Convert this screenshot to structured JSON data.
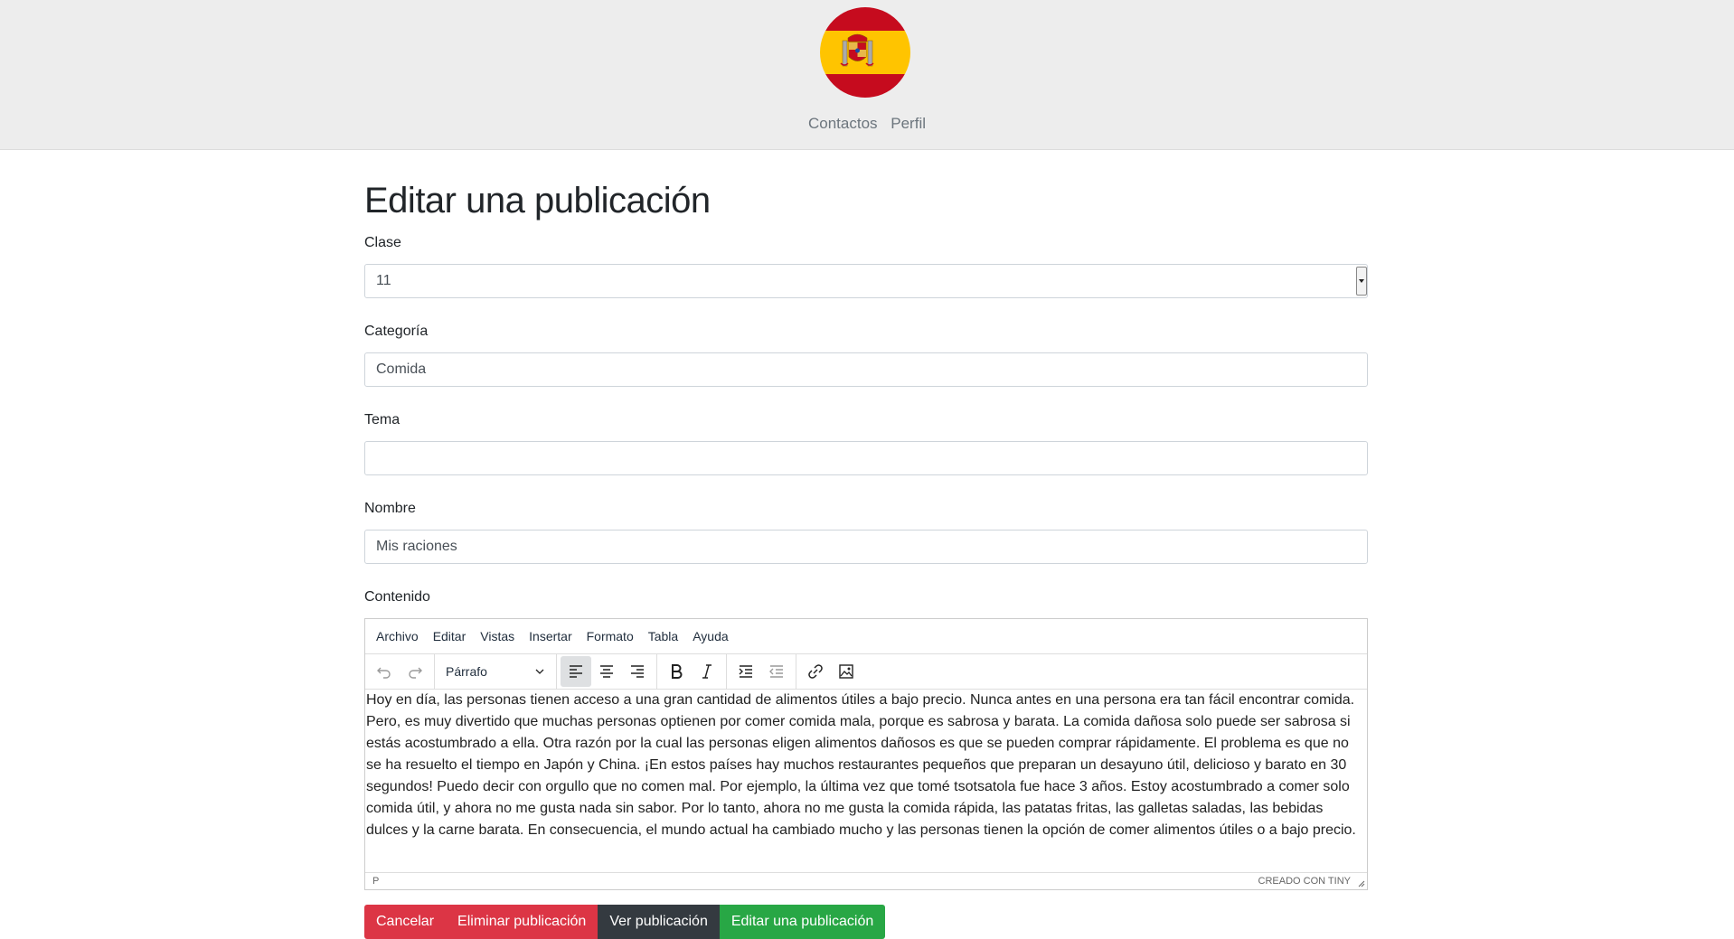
{
  "header": {
    "logo_icon": "spain-flag-coat-of-arms-logo",
    "nav": [
      "Contactos",
      "Perfil"
    ]
  },
  "page": {
    "title": "Editar una publicación"
  },
  "form": {
    "clase": {
      "label": "Clase",
      "value": "11"
    },
    "categoria": {
      "label": "Categoría",
      "value": "Comida"
    },
    "tema": {
      "label": "Tema",
      "value": ""
    },
    "nombre": {
      "label": "Nombre",
      "value": "Mis raciones"
    },
    "contenido": {
      "label": "Contenido"
    }
  },
  "editor": {
    "menu": [
      "Archivo",
      "Editar",
      "Vistas",
      "Insertar",
      "Formato",
      "Tabla",
      "Ayuda"
    ],
    "format_value": "Párrafo",
    "toolbar_icons": [
      "undo-icon",
      "redo-icon",
      "align-left-icon",
      "align-center-icon",
      "align-right-icon",
      "bold-icon",
      "italic-icon",
      "indent-icon",
      "outdent-icon",
      "link-icon",
      "image-icon"
    ],
    "content": "Hoy en día, las personas tienen acceso a una gran cantidad de alimentos útiles a bajo precio. Nunca antes en una persona era tan fácil encontrar comida. Pero, es muy divertido que muchas personas optienen por comer comida mala, porque es sabrosa y barata. La comida dañosa solo puede ser sabrosa si estás acostumbrado a ella. Otra razón por la cual las personas eligen alimentos dañosos es que se pueden comprar rápidamente. El problema es que no se ha resuelto el tiempo en Japón y China. ¡En estos países hay muchos restaurantes pequeños que preparan un desayuno útil, delicioso y barato en 30 segundos! Puedo decir con orgullo que no comen mal. Por ejemplo, la última vez que tomé tsotsatola fue hace 3 años. Estoy acostumbrado a comer solo comida útil, y ahora no me gusta nada sin sabor. Por lo tanto, ahora no me gusta la comida rápida, las patatas fritas, las galletas saladas, las bebidas dulces y la carne barata. En consecuencia, el mundo actual ha cambiado mucho y las personas tienen la opción de comer alimentos útiles o a bajo precio.",
    "status_path": "P",
    "branding": "CREADO CON TINY"
  },
  "buttons": {
    "cancel": "Cancelar",
    "delete": "Eliminar publicación",
    "view": "Ver publicación",
    "edit": "Editar una publicación"
  },
  "colors": {
    "danger": "#dc3545",
    "dark": "#343a40",
    "success": "#28a745",
    "header_bg": "#ededed"
  }
}
